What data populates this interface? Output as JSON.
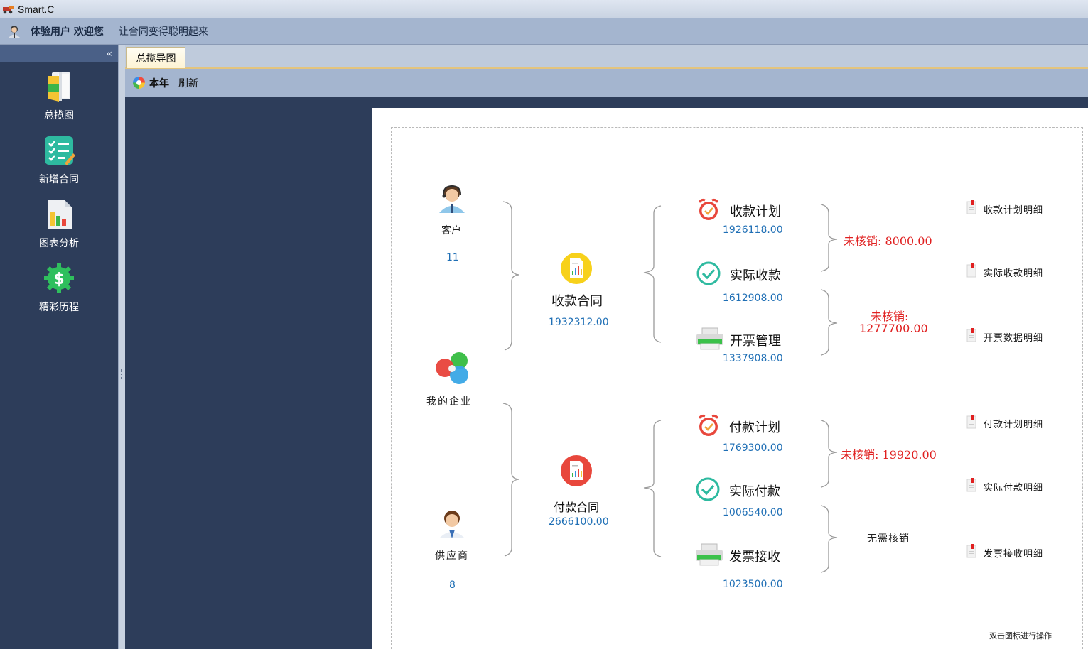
{
  "window": {
    "title": "Smart.C"
  },
  "header": {
    "welcome": "体验用户 欢迎您",
    "slogan": "让合同变得聪明起来"
  },
  "sidebar": {
    "collapse_label": "«",
    "items": [
      {
        "label": "总揽图",
        "icon": "overview-book-icon"
      },
      {
        "label": "新增合同",
        "icon": "checklist-icon"
      },
      {
        "label": "图表分析",
        "icon": "bar-chart-icon"
      },
      {
        "label": "精彩历程",
        "icon": "dollar-gear-icon"
      }
    ]
  },
  "tabs": [
    {
      "label": "总揽导图",
      "active": true
    }
  ],
  "toolbar": {
    "year_label": "本年",
    "refresh_label": "刷新"
  },
  "diagram": {
    "customer": {
      "label": "客户",
      "count": "11"
    },
    "my_company": {
      "label": "我的企业"
    },
    "supplier": {
      "label": "供应商",
      "count": "8"
    },
    "receivable_contract": {
      "label": "收款合同",
      "value": "1932312.00"
    },
    "payable_contract": {
      "label": "付款合同",
      "value": "2666100.00"
    },
    "receipt_plan": {
      "label": "收款计划",
      "value": "1926118.00"
    },
    "actual_receipt": {
      "label": "实际收款",
      "value": "1612908.00"
    },
    "invoice_manage": {
      "label": "开票管理",
      "value": "1337908.00"
    },
    "payment_plan": {
      "label": "付款计划",
      "value": "1769300.00"
    },
    "actual_payment": {
      "label": "实际付款",
      "value": "1006540.00"
    },
    "invoice_receive": {
      "label": "发票接收",
      "value": "1023500.00"
    },
    "unverified_1": "未核销: 8000.00",
    "unverified_2_label": "未核销:",
    "unverified_2_value": "1277700.00",
    "unverified_3": "未核销: 19920.00",
    "no_verify": "无需核销",
    "details": [
      "收款计划明细",
      "实际收款明细",
      "开票数据明细",
      "付款计划明细",
      "实际付款明细",
      "发票接收明细"
    ],
    "hint": "双击图标进行操作"
  },
  "colors": {
    "sidebar_bg": "#2d3d5a",
    "header_bg": "#a4b5cf",
    "value_blue": "#1f6fb5",
    "alert_red": "#e02020"
  }
}
